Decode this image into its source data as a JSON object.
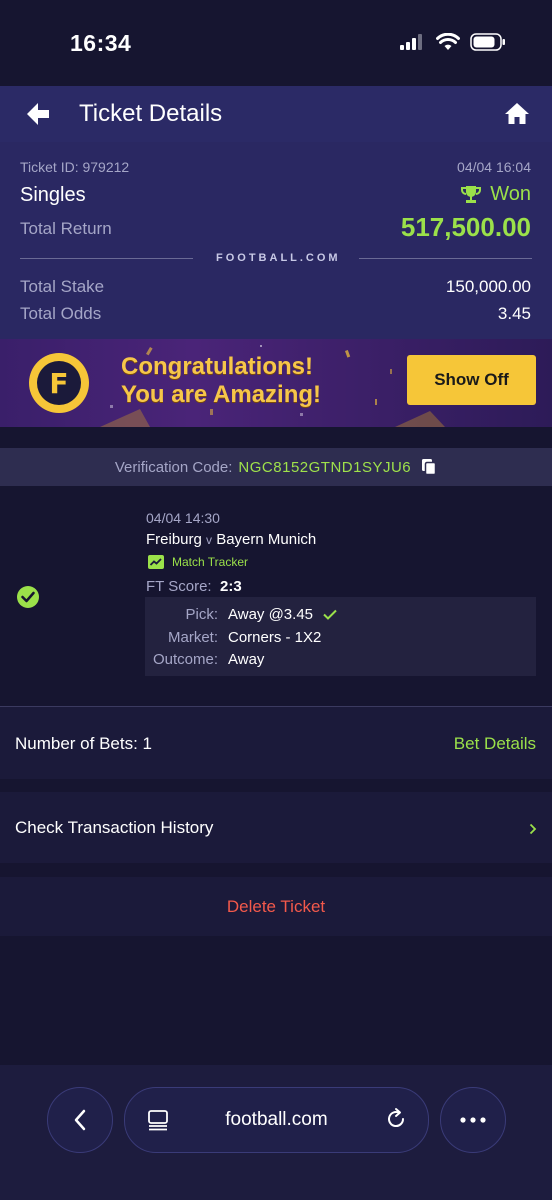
{
  "status_bar": {
    "time": "16:34"
  },
  "header": {
    "title": "Ticket Details"
  },
  "summary": {
    "ticket_id": "Ticket ID: 979212",
    "date": "04/04 16:04",
    "bet_type": "Singles",
    "status": "Won",
    "total_return_label": "Total Return",
    "total_return_value": "517,500.00",
    "brand": "FOOTBALL.COM",
    "total_stake_label": "Total Stake",
    "total_stake_value": "150,000.00",
    "total_odds_label": "Total Odds",
    "total_odds_value": "3.45"
  },
  "banner": {
    "line1": "Congratulations!",
    "line2": "You are Amazing!",
    "show_off_label": "Show Off"
  },
  "verification": {
    "label": "Verification Code:",
    "code": "NGC8152GTND1SYJU6"
  },
  "bet": {
    "datetime": "04/04 14:30",
    "home": "Freiburg",
    "vs": "v",
    "away": "Bayern Munich",
    "match_tracker": "Match Tracker",
    "ft_score_label": "FT Score:",
    "ft_score_value": "2:3",
    "pick_label": "Pick:",
    "pick_value": "Away @3.45",
    "market_label": "Market:",
    "market_value": "Corners - 1X2",
    "outcome_label": "Outcome:",
    "outcome_value": "Away"
  },
  "rows": {
    "num_bets": "Number of Bets: 1",
    "bet_details": "Bet Details",
    "transaction_history": "Check Transaction History",
    "delete_ticket": "Delete Ticket"
  },
  "browser": {
    "url": "football.com"
  },
  "colors": {
    "accent_green": "#9be14a",
    "header_bg": "#2b2a66",
    "delete_red": "#f3594b",
    "banner_yellow": "#f6c638"
  },
  "icons": [
    "back-arrow-icon",
    "home-icon",
    "trophy-icon",
    "copy-icon",
    "check-circle-icon",
    "chart-icon",
    "check-icon",
    "chevron-right-icon",
    "browser-back-icon",
    "tabs-icon",
    "reload-icon",
    "more-icon"
  ]
}
